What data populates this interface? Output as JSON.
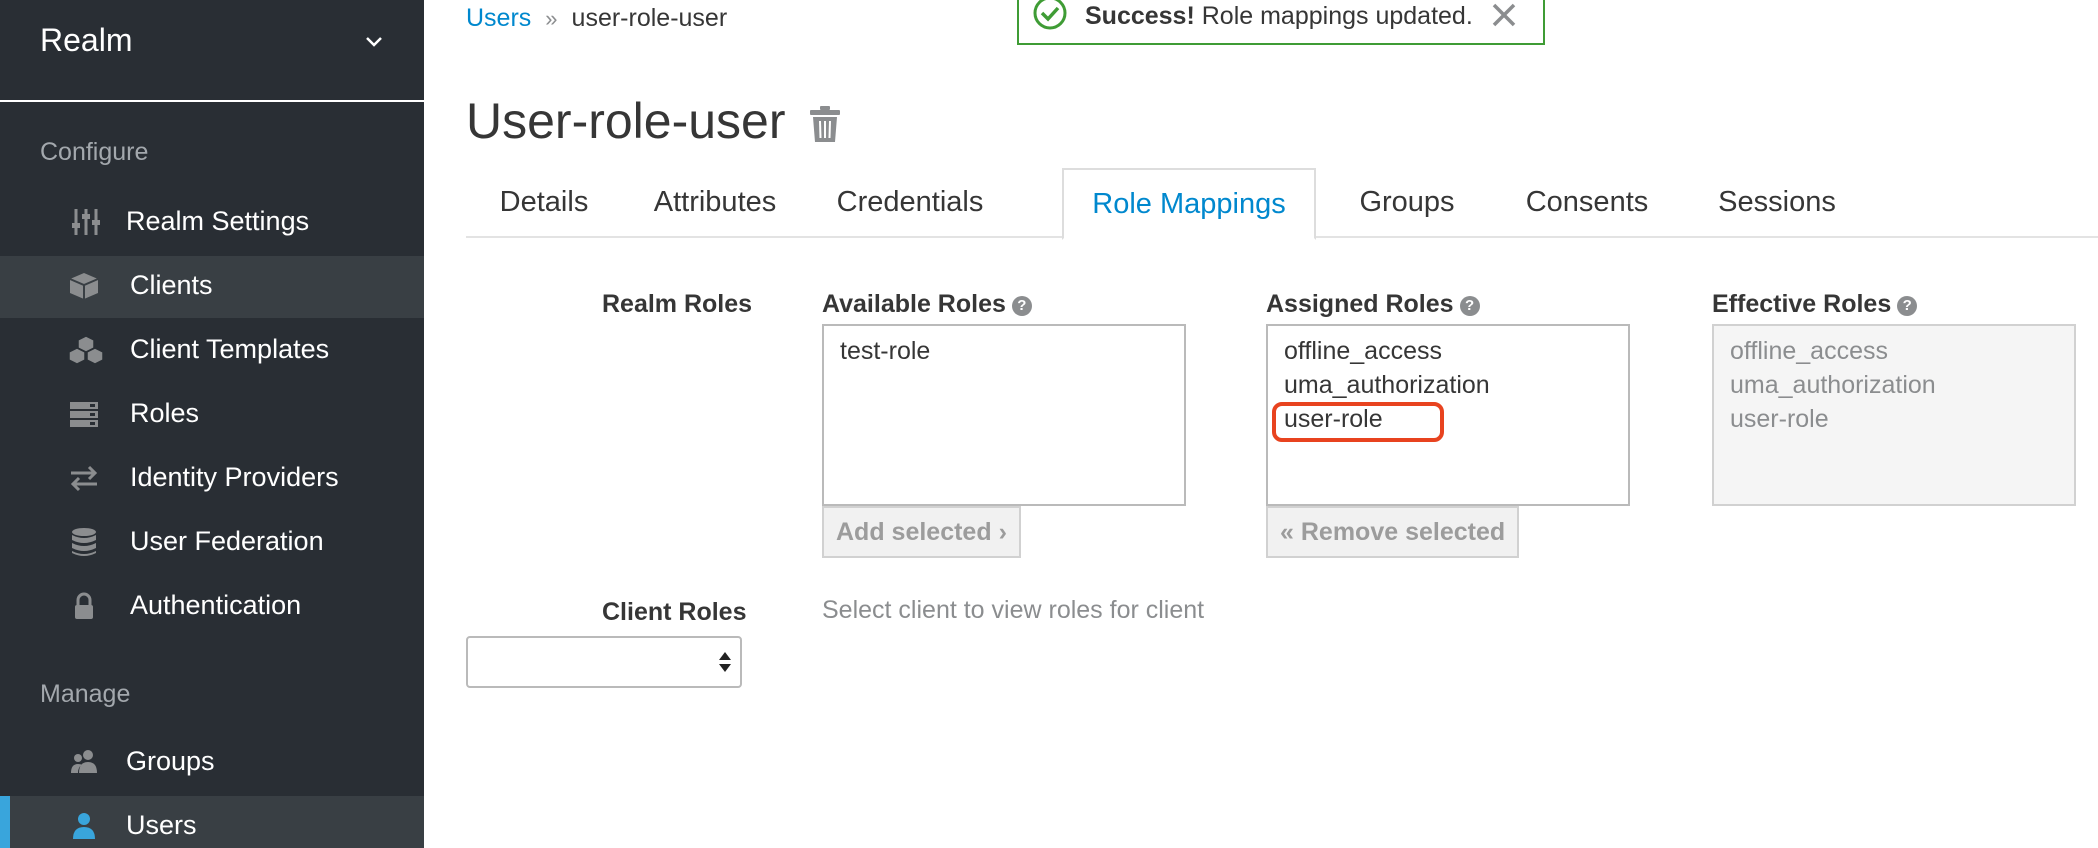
{
  "sidebar": {
    "realm_name": "Realm",
    "configure_label": "Configure",
    "manage_label": "Manage",
    "items": [
      {
        "label": "Realm Settings",
        "icon": "sliders-icon"
      },
      {
        "label": "Clients",
        "icon": "cube-icon"
      },
      {
        "label": "Client Templates",
        "icon": "cubes-icon"
      },
      {
        "label": "Roles",
        "icon": "server-icon"
      },
      {
        "label": "Identity Providers",
        "icon": "exchange-icon"
      },
      {
        "label": "User Federation",
        "icon": "database-icon"
      },
      {
        "label": "Authentication",
        "icon": "lock-icon"
      }
    ],
    "manage_items": [
      {
        "label": "Groups",
        "icon": "users-icon"
      },
      {
        "label": "Users",
        "icon": "user-icon"
      }
    ],
    "colors": {
      "background": "#292e34",
      "active_accent": "#39a5dc",
      "active_background": "#393f44"
    }
  },
  "breadcrumb": {
    "parent": "Users",
    "current": "user-role-user"
  },
  "toast": {
    "title": "Success!",
    "message": "Role mappings updated.",
    "color": "#3f9c35"
  },
  "page": {
    "title": "User-role-user"
  },
  "tabs": [
    {
      "label": "Details"
    },
    {
      "label": "Attributes"
    },
    {
      "label": "Credentials"
    },
    {
      "label": "Role Mappings",
      "active": true
    },
    {
      "label": "Groups"
    },
    {
      "label": "Consents"
    },
    {
      "label": "Sessions"
    }
  ],
  "role_mappings": {
    "realm_roles_label": "Realm Roles",
    "available": {
      "label": "Available Roles",
      "items": [
        "test-role"
      ],
      "button": "Add selected"
    },
    "assigned": {
      "label": "Assigned Roles",
      "items": [
        "offline_access",
        "uma_authorization",
        "user-role"
      ],
      "button": "Remove selected"
    },
    "effective": {
      "label": "Effective Roles",
      "items": [
        "offline_access",
        "uma_authorization",
        "user-role"
      ]
    },
    "client_roles_label": "Client Roles",
    "client_hint": "Select client to view roles for client",
    "client_select_value": ""
  },
  "colors": {
    "link": "#0088ce",
    "highlight": "#e8431f"
  }
}
